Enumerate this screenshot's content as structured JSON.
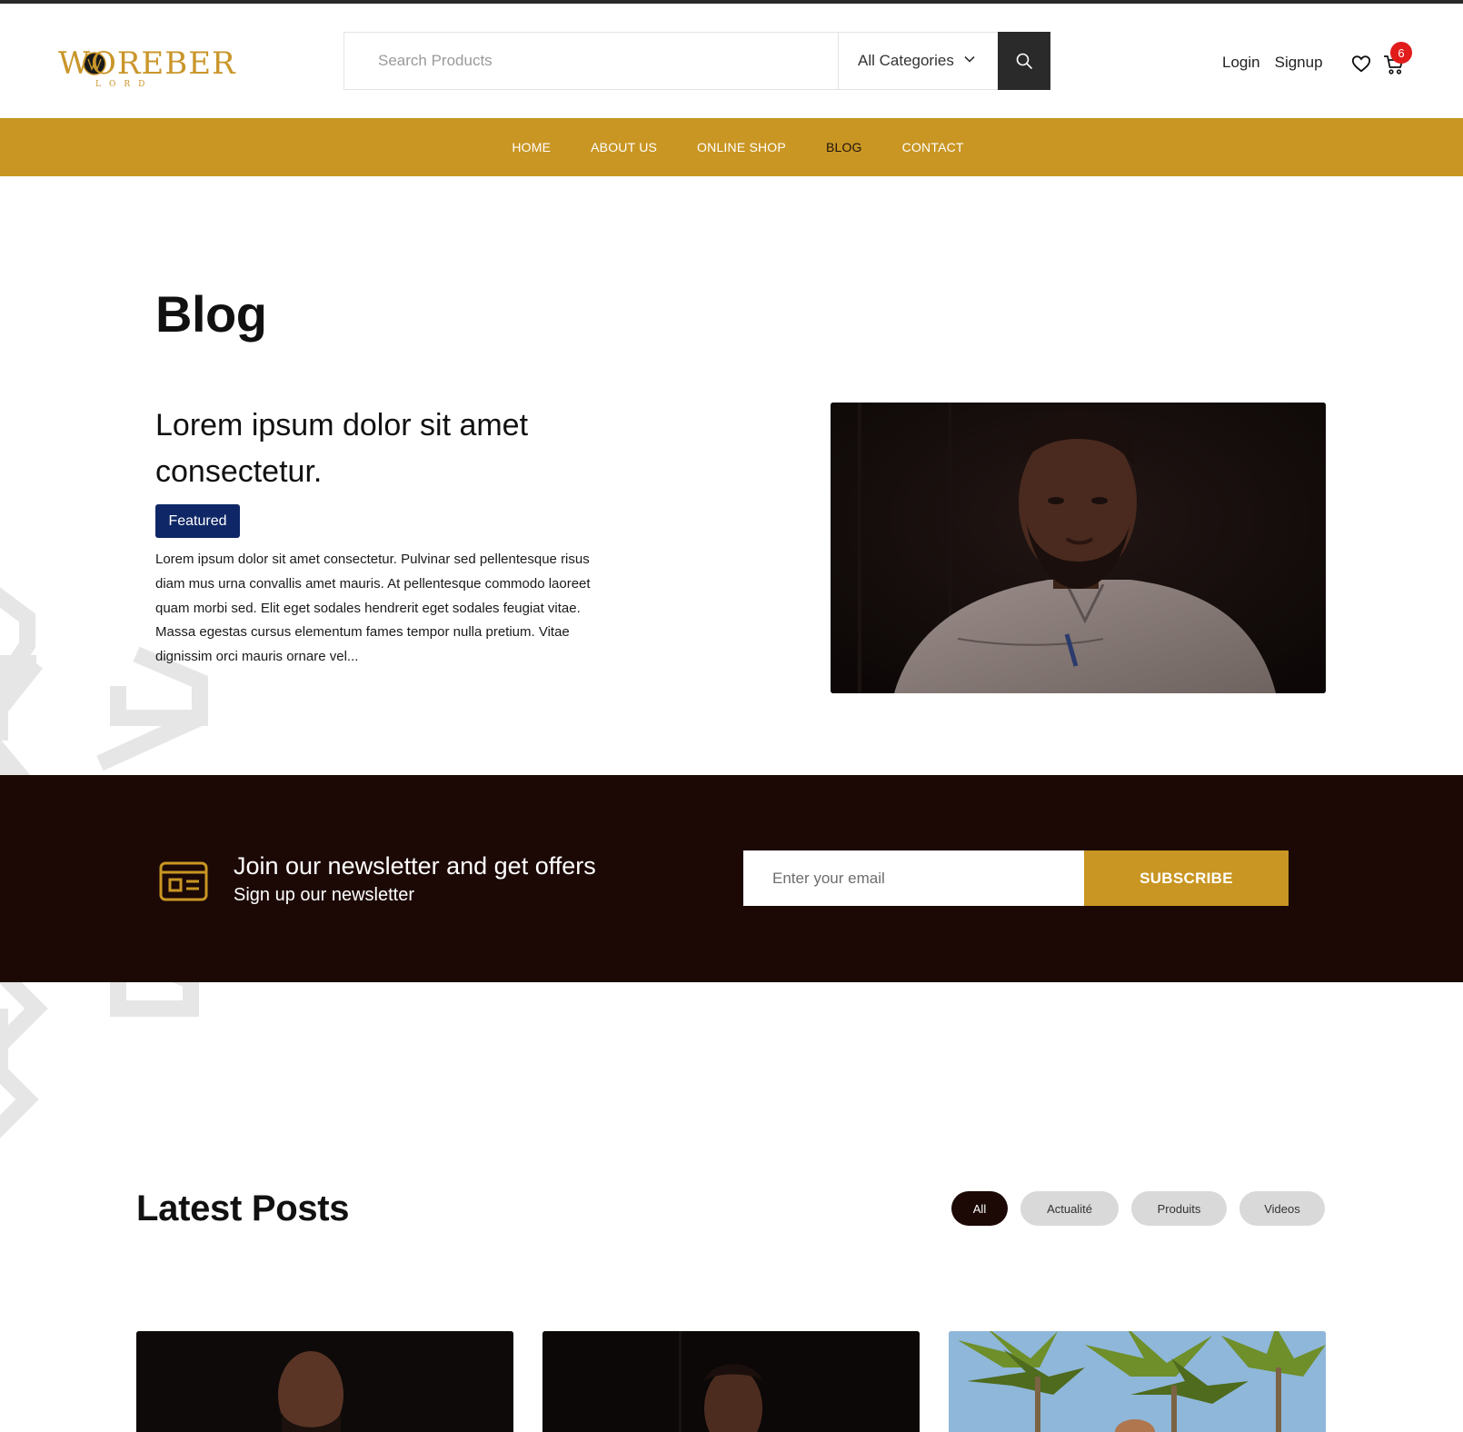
{
  "colors": {
    "gold": "#c99623",
    "dark_brown": "#1c0906",
    "navy_badge": "#0f2766",
    "cart_badge_red": "#e21b1b"
  },
  "header": {
    "logo_text": "WOREBER",
    "logo_sub": "LORD",
    "search": {
      "placeholder": "Search Products"
    },
    "category_select": {
      "selected": "All Categories"
    },
    "login": "Login",
    "signup": "Signup",
    "cart_count": "6"
  },
  "nav": {
    "items": [
      "HOME",
      "ABOUT US",
      "ONLINE SHOP",
      "BLOG",
      "CONTACT"
    ],
    "active": "BLOG"
  },
  "blog": {
    "page_title": "Blog",
    "featured_post": {
      "title": "Lorem ipsum dolor sit amet consectetur.",
      "badge": "Featured",
      "excerpt": "Lorem ipsum dolor sit amet consectetur. Pulvinar sed pellentesque risus diam mus urna convallis amet mauris. At pellentesque commodo laoreet quam morbi sed. Elit eget sodales hendrerit eget sodales feugiat vitae. Massa egestas cursus elementum fames tempor nulla pretium. Vitae dignissim orci mauris ornare vel..."
    }
  },
  "newsletter": {
    "icon": "newspaper-icon",
    "title": "Join our newsletter and get offers",
    "subtitle": "Sign up our newsletter",
    "email_placeholder": "Enter your email",
    "button": "SUBSCRIBE"
  },
  "latest_posts": {
    "title": "Latest Posts",
    "filters": [
      "All",
      "Actualité",
      "Produits",
      "Videos"
    ],
    "active_filter": "All"
  }
}
